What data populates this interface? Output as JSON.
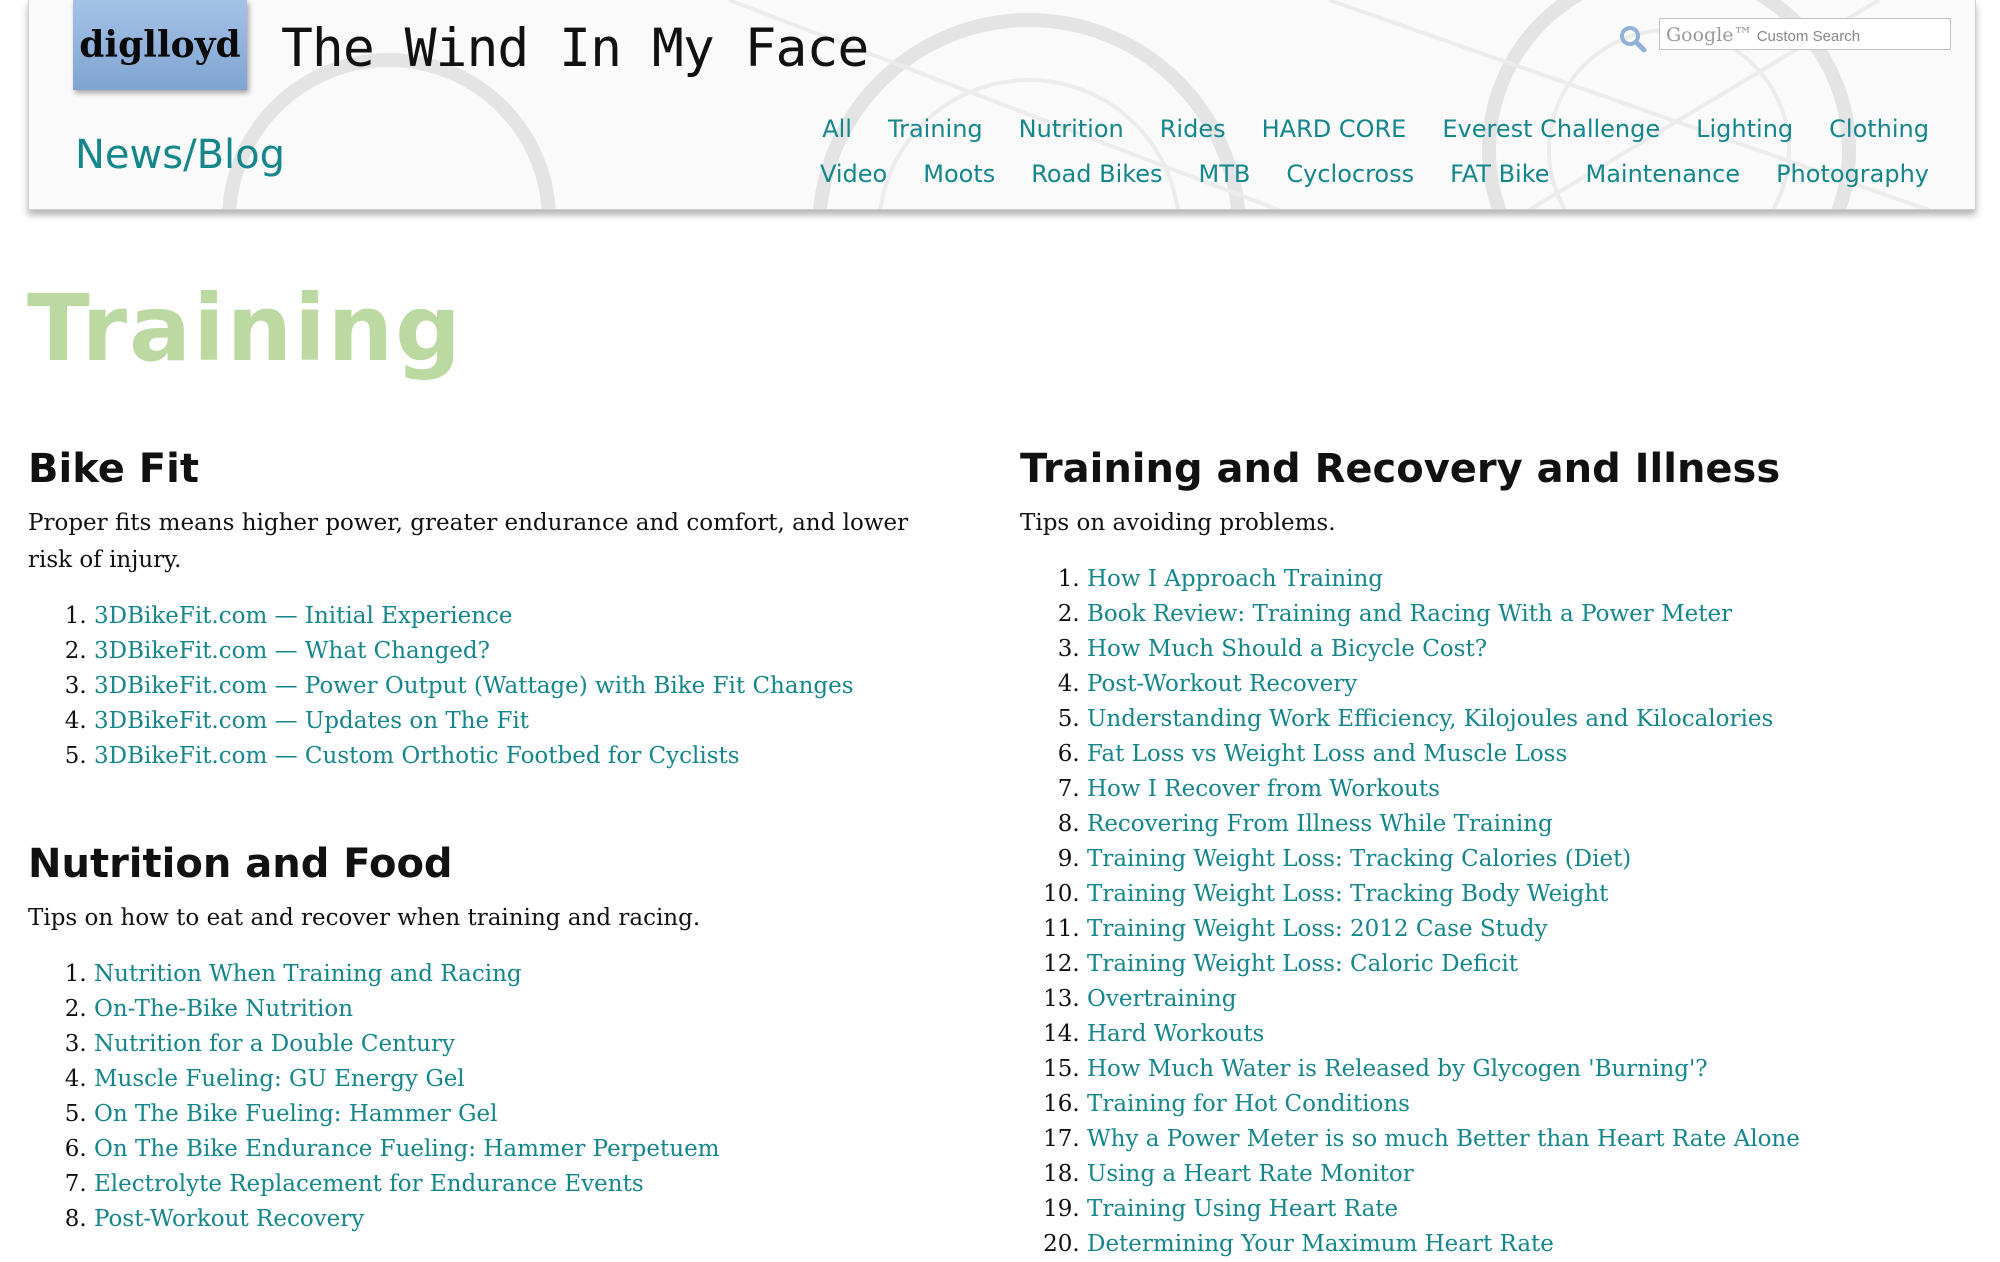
{
  "header": {
    "logo": "diglloyd",
    "site_title": "The Wind In My Face",
    "section_label": "News/Blog",
    "search_brand": "Google™",
    "search_placeholder": "Custom Search",
    "nav_row1": [
      "All",
      "Training",
      "Nutrition",
      "Rides",
      "HARD CORE",
      "Everest Challenge",
      "Lighting",
      "Clothing"
    ],
    "nav_row2": [
      "Video",
      "Moots",
      "Road Bikes",
      "MTB",
      "Cyclocross",
      "FAT Bike",
      "Maintenance",
      "Photography"
    ]
  },
  "page": {
    "title": "Training"
  },
  "sections_left": [
    {
      "title": "Bike Fit",
      "description": "Proper fits means higher power, greater endurance and comfort, and lower risk of injury.",
      "items": [
        "3DBikeFit.com — Initial Experience",
        "3DBikeFit.com — What Changed?",
        "3DBikeFit.com — Power Output (Wattage) with Bike Fit Changes",
        "3DBikeFit.com — Updates on The Fit",
        "3DBikeFit.com — Custom Orthotic Footbed for Cyclists"
      ]
    },
    {
      "title": "Nutrition and Food",
      "description": "Tips on how to eat and recover when training and racing.",
      "items": [
        "Nutrition When Training and Racing",
        "On-The-Bike Nutrition",
        "Nutrition for a Double Century",
        "Muscle Fueling: GU Energy Gel",
        "On The Bike Fueling: Hammer Gel",
        "On The Bike Endurance Fueling: Hammer Perpetuem",
        "Electrolyte Replacement for Endurance Events",
        "Post-Workout Recovery"
      ]
    }
  ],
  "sections_right": [
    {
      "title": "Training and Recovery and Illness",
      "description": "Tips on avoiding problems.",
      "items": [
        "How I Approach Training",
        "Book Review: Training and Racing With a Power Meter",
        "How Much Should a Bicycle Cost?",
        "Post-Workout Recovery",
        "Understanding Work Efficiency, Kilojoules and Kilocalories",
        "Fat Loss vs Weight Loss and Muscle Loss",
        "How I Recover from Workouts",
        "Recovering From Illness While Training",
        "Training Weight Loss: Tracking Calories (Diet)",
        "Training Weight Loss: Tracking Body Weight",
        "Training Weight Loss: 2012 Case Study",
        "Training Weight Loss: Caloric Deficit",
        "Overtraining",
        "Hard Workouts",
        "How Much Water is Released by Glycogen 'Burning'?",
        "Training for Hot Conditions",
        "Why a Power Meter is so much Better than Heart Rate Alone",
        "Using a Heart Rate Monitor",
        "Training Using Heart Rate",
        "Determining Your Maximum Heart Rate"
      ]
    }
  ],
  "colors": {
    "link": "#14868c",
    "page_title": "#bcd9a2",
    "logo_bg": "#8fb0dc"
  }
}
